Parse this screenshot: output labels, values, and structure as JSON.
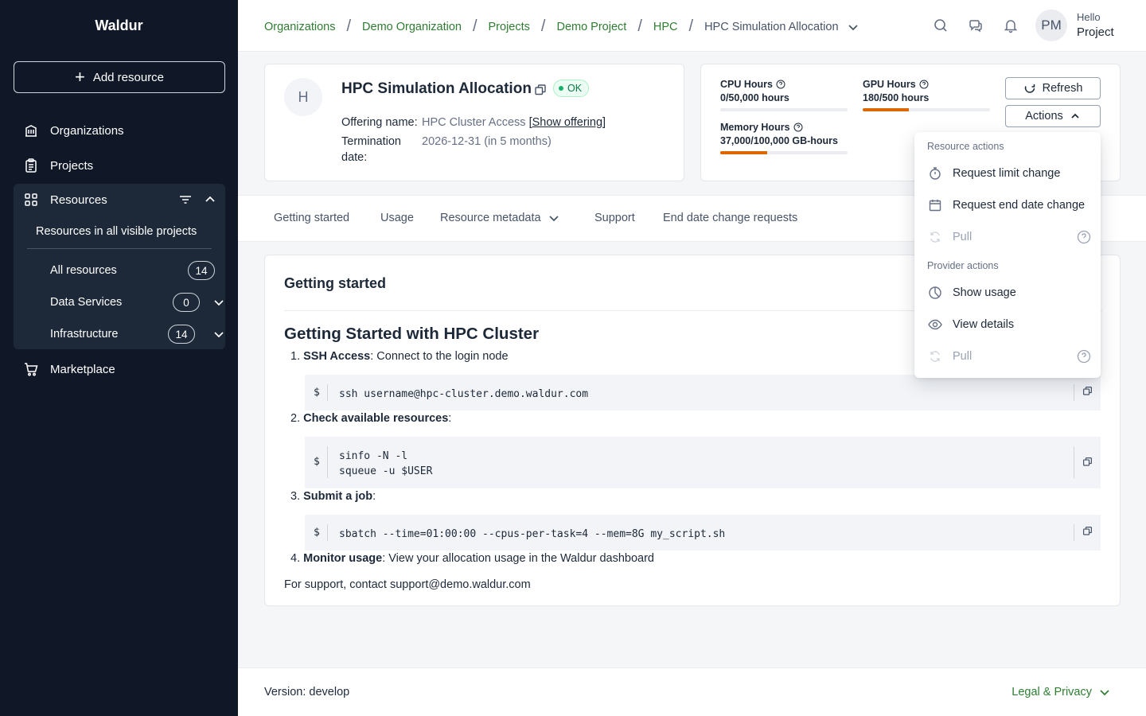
{
  "sidebar": {
    "brand": "Waldur",
    "add_resource": "Add resource",
    "organizations": "Organizations",
    "projects": "Projects",
    "resources": "Resources",
    "resources_sub": "Resources in all visible projects",
    "rows": [
      {
        "label": "All resources",
        "count": "14"
      },
      {
        "label": "Data Services",
        "count": "0"
      },
      {
        "label": "Infrastructure",
        "count": "14"
      }
    ],
    "marketplace": "Marketplace"
  },
  "breadcrumbs": [
    "Organizations",
    "Demo Organization",
    "Projects",
    "Demo Project",
    "HPC",
    "HPC Simulation Allocation"
  ],
  "user": {
    "initials": "PM",
    "greeting": "Hello",
    "name": "Project"
  },
  "resource": {
    "avatar": "H",
    "title": "HPC Simulation Allocation",
    "status": "OK",
    "offering_label": "Offering name:",
    "offering_value": "HPC Cluster Access",
    "offering_link": "[Show offering]",
    "termination_label_1": "Termination",
    "termination_label_2": "date:",
    "termination_value": "2026-12-31 (in 5 months)"
  },
  "quotas": [
    {
      "title": "CPU Hours",
      "value": "0/50,000 hours",
      "fraction": 0
    },
    {
      "title": "GPU Hours",
      "value": "180/500 hours",
      "fraction": 0.36
    },
    {
      "title": "Memory Hours",
      "value": "37,000/100,000 GB-hours",
      "fraction": 0.37
    }
  ],
  "buttons": {
    "refresh": "Refresh",
    "actions": "Actions"
  },
  "tabs": [
    "Getting started",
    "Usage",
    "Resource metadata",
    "Support",
    "End date change requests"
  ],
  "content": {
    "section_title": "Getting started",
    "doc_title": "Getting Started with HPC Cluster",
    "steps": [
      {
        "num": "1.",
        "bold": "SSH Access",
        "rest": ": Connect to the login node"
      },
      {
        "num": "2.",
        "bold": "Check available resources",
        "rest": ":"
      },
      {
        "num": "3.",
        "bold": "Submit a job",
        "rest": ":"
      },
      {
        "num": "4.",
        "bold": "Monitor usage",
        "rest": ": View your allocation usage in the Waldur dashboard"
      }
    ],
    "code_prompt": "$",
    "code": [
      "ssh username@hpc-cluster.demo.waldur.com",
      "sinfo -N -l\nsqueue -u $USER",
      "sbatch --time=01:00:00 --cpus-per-task=4 --mem=8G my_script.sh"
    ],
    "support": "For support, contact support@demo.waldur.com"
  },
  "dropdown": {
    "resource_group": "Resource actions",
    "request_limit": "Request limit change",
    "request_end_date": "Request end date change",
    "pull": "Pull",
    "provider_group": "Provider actions",
    "show_usage": "Show usage",
    "view_details": "View details",
    "pull2": "Pull"
  },
  "footer": {
    "version": "Version: develop",
    "legal": "Legal & Privacy"
  },
  "colors": {
    "sidebar": "#101828",
    "link_green": "#2e7d32",
    "progress": "#dc6803",
    "ok_green": "#17b26a"
  }
}
